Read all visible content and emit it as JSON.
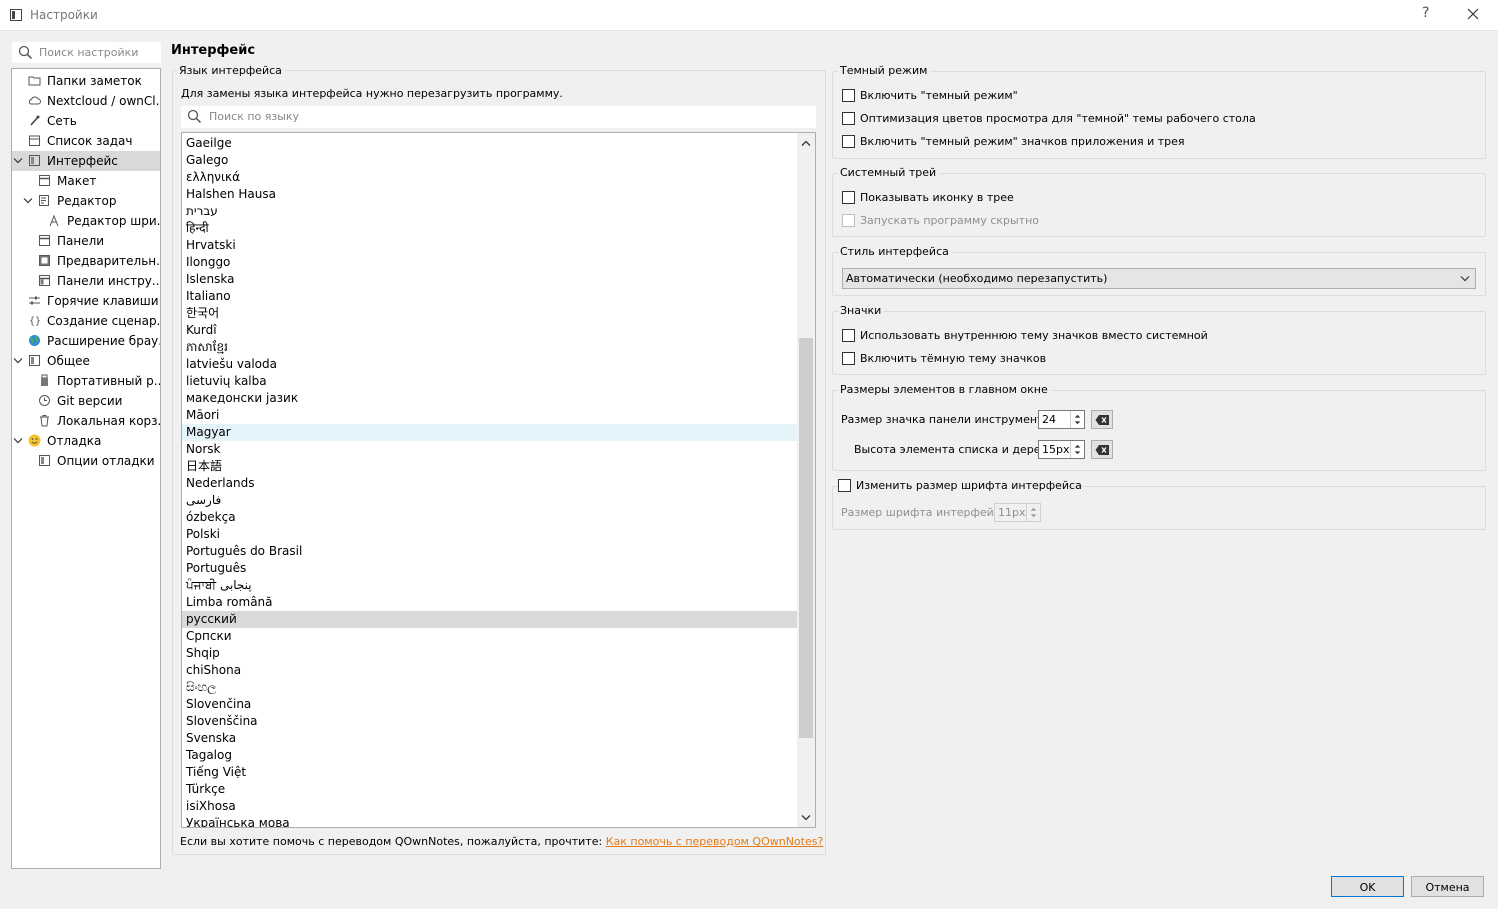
{
  "window": {
    "title": "Настройки",
    "help_label": "?"
  },
  "sidebar": {
    "search_placeholder": "Поиск настройки",
    "items": [
      {
        "label": "Папки заметок"
      },
      {
        "label": "Nextcloud / ownCl..."
      },
      {
        "label": "Сеть"
      },
      {
        "label": "Список задач"
      },
      {
        "label": "Интерфейс"
      },
      {
        "label": "Макет"
      },
      {
        "label": "Редактор"
      },
      {
        "label": "Редактор шри..."
      },
      {
        "label": "Панели"
      },
      {
        "label": "Предварительн..."
      },
      {
        "label": "Панели инстру..."
      },
      {
        "label": "Горячие клавиши"
      },
      {
        "label": "Создание сценар..."
      },
      {
        "label": "Расширение брау..."
      },
      {
        "label": "Общее"
      },
      {
        "label": "Портативный р..."
      },
      {
        "label": "Git версии"
      },
      {
        "label": "Локальная корз..."
      },
      {
        "label": "Отладка"
      },
      {
        "label": "Опции отладки"
      }
    ]
  },
  "page": {
    "title": "Интерфейс"
  },
  "language": {
    "group_title": "Язык интерфейса",
    "hint": "Для замены языка интерфейса нужно перезагрузить программу.",
    "search_placeholder": "Поиск по языку",
    "items": [
      "Gaeilge",
      "Galego",
      "ελληνικά",
      "Halshen Hausa",
      "עברית",
      "हिन्दी",
      "Hrvatski",
      "Ilonggo",
      "Islenska",
      "Italiano",
      "한국어",
      "Kurdî",
      "ភាសាខ្មែរ",
      "latviešu valoda",
      "lietuvių kalba",
      "македонски јазик",
      "Māori",
      "Magyar",
      "Norsk",
      "日本語",
      "Nederlands",
      "فارسی",
      "ózbekça",
      "Polski",
      "Português do Brasil",
      "Português",
      "ਪੰਜਾਬੀ پنجابی",
      "Limba română",
      "русский",
      "Српски",
      "Shqip",
      "chiShona",
      "සිංහල",
      "Slovenčina",
      "Slovenščina",
      "Svenska",
      "Tagalog",
      "Tiếng Việt",
      "Türkçe",
      "isiXhosa",
      "Українська мова"
    ],
    "selected": "русский",
    "hovered": "Magyar",
    "footer_text": "Если вы хотите помочь с переводом QOwnNotes, пожалуйста, прочтите:",
    "footer_link": "Как помочь с переводом QOwnNotes?"
  },
  "dark_mode": {
    "group_title": "Темный режим",
    "options": [
      "Включить \"темный режим\"",
      "Оптимизация цветов просмотра для \"темной\" темы рабочего стола",
      "Включить \"темный режим\" значков приложения и трея"
    ]
  },
  "tray": {
    "group_title": "Системный трей",
    "options": [
      "Показывать иконку в трее",
      "Запускать программу скрытно"
    ]
  },
  "style": {
    "group_title": "Стиль интерфейса",
    "selected": "Автоматически (необходимо перезапустить)"
  },
  "icons": {
    "group_title": "Значки",
    "options": [
      "Использовать внутреннюю тему значков вместо системной",
      "Включить тёмную тему значков"
    ]
  },
  "sizes": {
    "group_title": "Размеры элементов в главном окне",
    "toolbar_icon_label": "Размер значка панели инструментов:",
    "toolbar_icon_value": "24",
    "tree_item_label": "Высота элемента списка и дерева:",
    "tree_item_value": "15px"
  },
  "font": {
    "toggle_label": "Изменить размер шрифта интерфейса",
    "size_label": "Размер шрифта интерфейса:",
    "size_value": "11px"
  },
  "buttons": {
    "ok": "OK",
    "cancel": "Отмена"
  }
}
